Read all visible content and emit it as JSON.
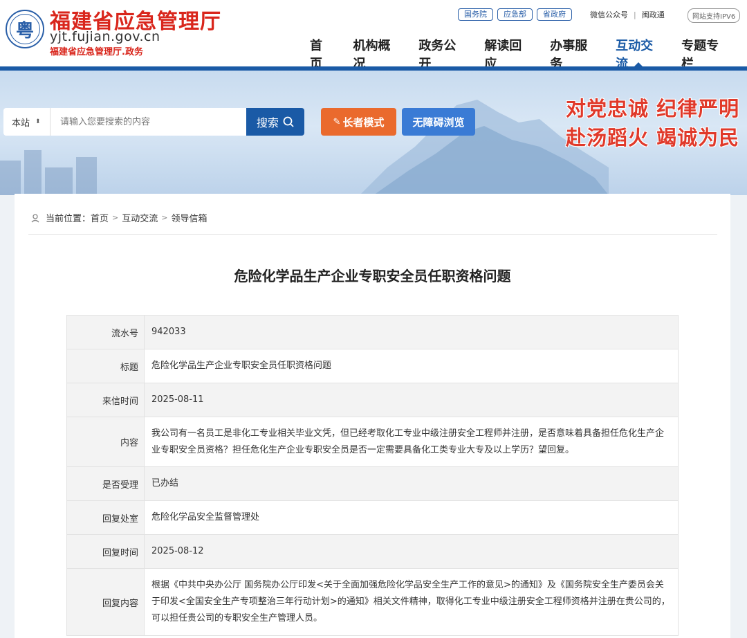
{
  "header": {
    "logo_char": "粤",
    "site_name": "福建省应急管理厅",
    "domain": "yjt.fujian.gov.cn",
    "sub_name": "福建省应急管理厅.政务",
    "top_links": [
      "国务院",
      "应急部",
      "省政府"
    ],
    "wechat": "微信公众号",
    "separator": "|",
    "minzhengtong": "闽政通",
    "ipv6": "网站支持IPV6"
  },
  "nav": {
    "items": [
      "首页",
      "机构概况",
      "政务公开",
      "解读回应",
      "办事服务",
      "互动交流",
      "专题专栏"
    ],
    "active": "互动交流"
  },
  "search": {
    "scope": "本站",
    "placeholder": "请输入您要搜索的内容",
    "button": "搜索"
  },
  "modes": {
    "elder": "长者模式",
    "access": "无障碍浏览"
  },
  "slogan": {
    "line1": "对党忠诚 纪律严明",
    "line2": "赴汤蹈火 竭诚为民"
  },
  "breadcrumb": {
    "prefix": "当前位置：",
    "items": [
      "首页",
      "互动交流",
      "领导信箱"
    ],
    "sep": ">"
  },
  "letter": {
    "title": "危险化学品生产企业专职安全员任职资格问题",
    "rows": [
      {
        "label": "流水号",
        "value": "942033"
      },
      {
        "label": "标题",
        "value": "危险化学品生产企业专职安全员任职资格问题"
      },
      {
        "label": "来信时间",
        "value": "2025-08-11"
      },
      {
        "label": "内容",
        "value": "我公司有一名员工是非化工专业相关毕业文凭，但已经考取化工专业中级注册安全工程师并注册，是否意味着具备担任危化生产企业专职安全员资格？担任危化生产企业专职安全员是否一定需要具备化工类专业大专及以上学历？望回复。"
      },
      {
        "label": "是否受理",
        "value": "已办结"
      },
      {
        "label": "回复处室",
        "value": "危险化学品安全监督管理处"
      },
      {
        "label": "回复时间",
        "value": "2025-08-12"
      },
      {
        "label": "回复内容",
        "value": "根据《中共中央办公厅 国务院办公厅印发<关于全面加强危险化学品安全生产工作的意见>的通知》及《国务院安全生产委员会关于印发<全国安全生产专项整治三年行动计划>的通知》相关文件精神，取得化工专业中级注册安全工程师资格并注册在贵公司的，可以担任贵公司的专职安全生产管理人员。"
      }
    ]
  }
}
